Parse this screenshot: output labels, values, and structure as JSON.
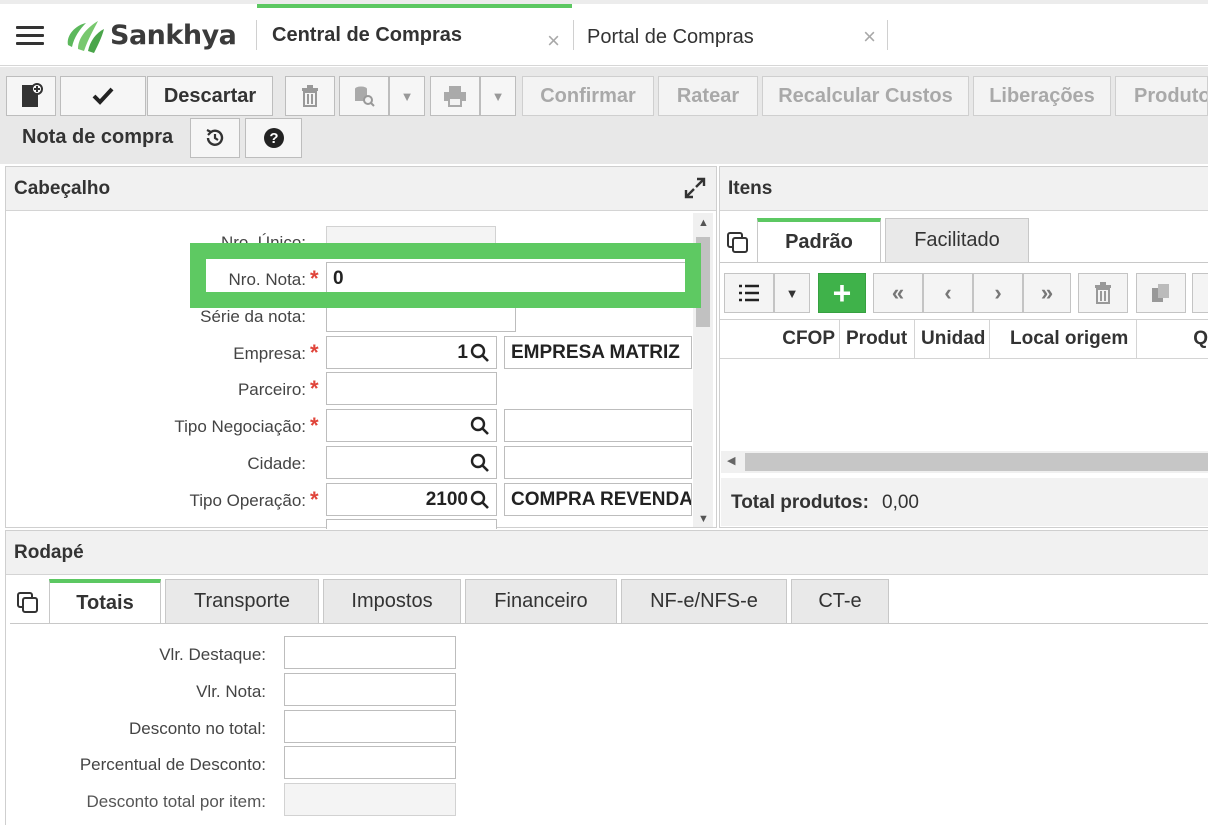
{
  "app": {
    "logo_text": "Sankhya",
    "tabs": [
      {
        "label": "Central de Compras",
        "active": true
      },
      {
        "label": "Portal de Compras",
        "active": false
      }
    ],
    "close_glyph": "×",
    "accent_color": "#5cc862"
  },
  "toolbar": {
    "discard_label": "Descartar",
    "confirm_label": "Confirmar",
    "ratear_label": "Ratear",
    "recalc_label": "Recalcular Custos",
    "liberacoes_label": "Liberações",
    "produtos_label": "Produtos",
    "section_label": "Nota de compra",
    "icons": [
      "new-document-icon",
      "check-icon",
      "trash-icon",
      "database-search-icon",
      "printer-icon",
      "history-icon",
      "help-icon"
    ]
  },
  "cabecalho": {
    "title": "Cabeçalho",
    "fields": {
      "nro_unico": {
        "label": "Nro. Único:",
        "value": ""
      },
      "nro_nota": {
        "label": "Nro. Nota:",
        "value": "0"
      },
      "serie": {
        "label": "Série da nota:",
        "value": ""
      },
      "empresa": {
        "label": "Empresa:",
        "code": "1",
        "desc": "EMPRESA MATRIZ"
      },
      "parceiro": {
        "label": "Parceiro:",
        "value": ""
      },
      "tipo_negociacao": {
        "label": "Tipo Negociação:",
        "code": "",
        "desc": ""
      },
      "cidade": {
        "label": "Cidade:",
        "code": "",
        "desc": ""
      },
      "tipo_operacao": {
        "label": "Tipo Operação:",
        "code": "2100",
        "desc": "COMPRA REVENDA"
      }
    },
    "required_mark": "*"
  },
  "itens": {
    "title": "Itens",
    "tabs": [
      {
        "label": "Padrão",
        "active": true
      },
      {
        "label": "Facilitado",
        "active": false
      }
    ],
    "columns": [
      "CFOP",
      "Produt",
      "Unidad",
      "Local origem",
      "Q"
    ],
    "total_label": "Total produtos:",
    "total_value": "0,00",
    "add_glyph": "+"
  },
  "rodape": {
    "title": "Rodapé",
    "tabs": [
      {
        "label": "Totais",
        "active": true
      },
      {
        "label": "Transporte",
        "active": false
      },
      {
        "label": "Impostos",
        "active": false
      },
      {
        "label": "Financeiro",
        "active": false
      },
      {
        "label": "NF-e/NFS-e",
        "active": false
      },
      {
        "label": "CT-e",
        "active": false
      }
    ],
    "fields": [
      {
        "label": "Vlr. Destaque:",
        "value": ""
      },
      {
        "label": "Vlr. Nota:",
        "value": ""
      },
      {
        "label": "Desconto no total:",
        "value": ""
      },
      {
        "label": "Percentual de Desconto:",
        "value": ""
      },
      {
        "label": "Desconto total por item:",
        "value": ""
      }
    ]
  }
}
